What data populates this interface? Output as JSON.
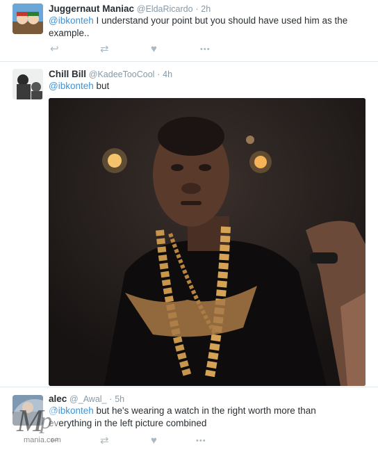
{
  "tweets": [
    {
      "fullname": "Juggernaut Maniac",
      "username": "@EldaRicardo",
      "separator": "·",
      "time": "2h",
      "mention": "@ibkonteh",
      "text": " I understand your point but you should have used him as the example..",
      "avatar_icon": "cartoon-avatar"
    },
    {
      "fullname": "Chill Bill",
      "username": "@KadeeTooCool",
      "separator": "·",
      "time": "4h",
      "mention": "@ibkonteh",
      "text": " but",
      "avatar_icon": "photo-avatar",
      "media": "photo of man wearing gold chains"
    },
    {
      "fullname": "alec",
      "username": "@_Awal_",
      "separator": "·",
      "time": "5h",
      "mention": "@ibkonteh",
      "text": " but he's wearing a watch in the right worth more than everything in the left picture combined",
      "avatar_icon": "photo-avatar"
    }
  ],
  "actions": {
    "reply_icon": "↩",
    "retweet_icon": "⇄",
    "like_icon": "♥",
    "more_icon": "•••"
  },
  "watermark": "Mp mania.com",
  "colors": {
    "link": "#3b94d9",
    "muted": "#8899a6",
    "action": "#aab8c2"
  }
}
